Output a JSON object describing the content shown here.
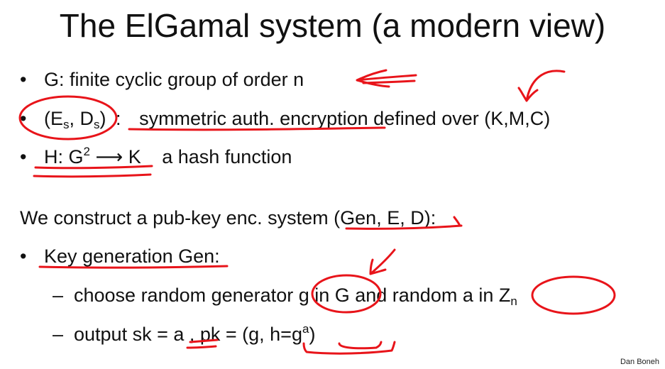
{
  "slide": {
    "title": "The ElGamal system  (a modern view)",
    "bullets": {
      "marker": "•",
      "group": "G:   finite cyclic group of order n",
      "cipher": {
        "pair_open": "(E",
        "pair_sub1": "s",
        "pair_mid": ", D",
        "pair_sub2": "s",
        "pair_close": ")",
        "colon": ":",
        "desc": "symmetric auth. encryption defined over (K,M,C)"
      },
      "hash": {
        "pre": "H: G",
        "sup": "2",
        "post": " ⟶ K",
        "desc": "a hash function"
      }
    },
    "construct": "We construct a pub-key enc. system (Gen, E, D):",
    "keygen": {
      "label": "Key generation Gen",
      "colon": ":",
      "dash": "–",
      "choose": "choose random generator  g in G     and    random  a in Z",
      "choose_sub": "n",
      "output_pre": "output    sk = a     ,     pk = (g, h=g",
      "output_sup": "a",
      "output_post": ")"
    },
    "credit": "Dan Boneh"
  },
  "colors": {
    "ink": "#e8141a",
    "text": "#111111",
    "background": "#ffffff"
  }
}
